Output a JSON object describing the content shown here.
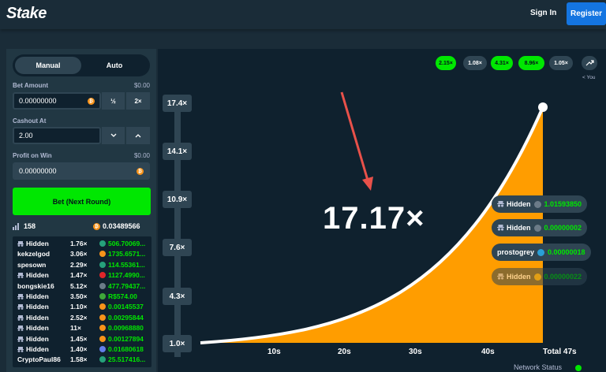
{
  "header": {
    "logo": "Stake",
    "signin_label": "Sign In",
    "register_label": "Register"
  },
  "controls": {
    "tab_manual": "Manual",
    "tab_auto": "Auto",
    "bet_amount_label": "Bet Amount",
    "bet_amount_usd": "$0.00",
    "bet_amount_value": "0.00000000",
    "half_label": "½",
    "double_label": "2×",
    "cashout_label": "Cashout At",
    "cashout_value": "2.00",
    "profit_label": "Profit on Win",
    "profit_usd": "$0.00",
    "profit_value": "0.00000000",
    "bet_button": "Bet (Next Round)"
  },
  "stats": {
    "player_count": "158",
    "total": "0.03489566"
  },
  "players": [
    {
      "name": "Hidden",
      "hidden": true,
      "mult": "1.76×",
      "amount": "506.70069...",
      "coin_color": "#26a17b"
    },
    {
      "name": "kekzelgod",
      "hidden": false,
      "mult": "3.06×",
      "amount": "1735.6571...",
      "coin_color": "#f7931a"
    },
    {
      "name": "spesown",
      "hidden": false,
      "mult": "2.29×",
      "amount": "114.55361...",
      "coin_color": "#26a17b"
    },
    {
      "name": "Hidden",
      "hidden": true,
      "mult": "1.47×",
      "amount": "1127.4990...",
      "coin_color": "#e0262a"
    },
    {
      "name": "bongskie16",
      "hidden": false,
      "mult": "5.12×",
      "amount": "477.79437...",
      "coin_color": "#6b7b88"
    },
    {
      "name": "Hidden",
      "hidden": true,
      "mult": "3.50×",
      "amount": "R$574.00",
      "coin_color": "#3fa73a"
    },
    {
      "name": "Hidden",
      "hidden": true,
      "mult": "1.10×",
      "amount": "0.00145537",
      "coin_color": "#f7931a"
    },
    {
      "name": "Hidden",
      "hidden": true,
      "mult": "2.52×",
      "amount": "0.00295844",
      "coin_color": "#f7931a"
    },
    {
      "name": "Hidden",
      "hidden": true,
      "mult": "11×",
      "amount": "0.00968880",
      "coin_color": "#f7931a"
    },
    {
      "name": "Hidden",
      "hidden": true,
      "mult": "1.45×",
      "amount": "0.00127894",
      "coin_color": "#f7931a"
    },
    {
      "name": "Hidden",
      "hidden": true,
      "mult": "1.40×",
      "amount": "0.01680618",
      "coin_color": "#627eea"
    },
    {
      "name": "CryptoPaul86",
      "hidden": false,
      "mult": "1.58×",
      "amount": "25.517416...",
      "coin_color": "#26a17b"
    }
  ],
  "history": [
    {
      "label": "2.15×",
      "style": "g"
    },
    {
      "label": "1.08×",
      "style": "d"
    },
    {
      "label": "4.31×",
      "style": "g"
    },
    {
      "label": "8.96×",
      "style": "g"
    },
    {
      "label": "1.05×",
      "style": "d"
    }
  ],
  "you_label": "< You",
  "graph": {
    "multiplier": "17.17×",
    "y_labels": [
      "17.4×",
      "14.1×",
      "10.9×",
      "7.6×",
      "4.3×",
      "1.0×"
    ],
    "x_labels": [
      "10s",
      "20s",
      "30s",
      "40s",
      "Total 47s"
    ]
  },
  "cashouts": [
    {
      "name": "Hidden",
      "hidden": true,
      "value": "1.01593850",
      "coin_color": "#6b7b88",
      "faded": false
    },
    {
      "name": "Hidden",
      "hidden": true,
      "value": "0.00000002",
      "coin_color": "#6b7b88",
      "faded": false
    },
    {
      "name": "prostogrey",
      "hidden": false,
      "value": "0.00000018",
      "coin_color": "#2a9fd6",
      "faded": false
    },
    {
      "name": "Hidden",
      "hidden": true,
      "value": "0.00000022",
      "coin_color": "#c9a227",
      "faded": true
    }
  ],
  "network_status": "Network Status",
  "colors": {
    "accent_green": "#00e701",
    "curve_fill": "#ff9d00",
    "register_blue": "#1475e1",
    "arrow": "#e8514a"
  }
}
